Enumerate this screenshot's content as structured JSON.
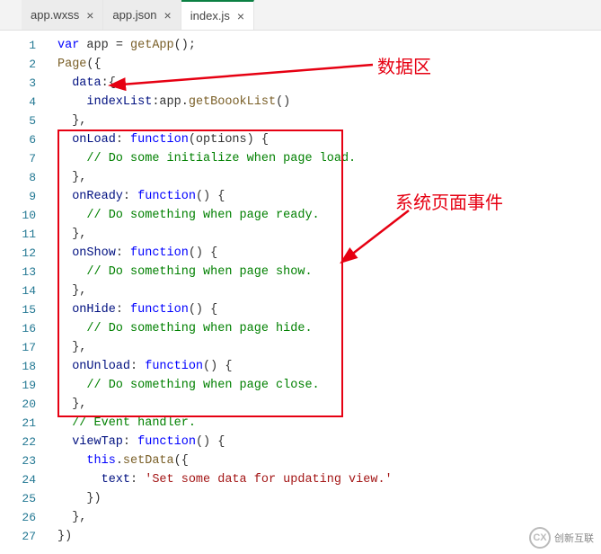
{
  "tabs": [
    {
      "label": "app.wxss",
      "active": false
    },
    {
      "label": "app.json",
      "active": false
    },
    {
      "label": "index.js",
      "active": true
    }
  ],
  "annotations": {
    "data_region": "数据区",
    "system_events": "系统页面事件"
  },
  "watermark": {
    "brand": "创新互联",
    "logo_text": "CX"
  },
  "code_lines": [
    {
      "n": 1,
      "segs": [
        [
          "kw",
          "var"
        ],
        [
          "punc",
          " app = "
        ],
        [
          "fn",
          "getApp"
        ],
        [
          "punc",
          "();"
        ]
      ]
    },
    {
      "n": 2,
      "segs": [
        [
          "fn",
          "Page"
        ],
        [
          "punc",
          "({"
        ]
      ]
    },
    {
      "n": 3,
      "segs": [
        [
          "punc",
          "  "
        ],
        [
          "prop",
          "data"
        ],
        [
          "punc",
          ":{"
        ]
      ]
    },
    {
      "n": 4,
      "segs": [
        [
          "punc",
          "    "
        ],
        [
          "prop",
          "indexList"
        ],
        [
          "punc",
          ":app."
        ],
        [
          "fn",
          "getBoookList"
        ],
        [
          "punc",
          "()"
        ]
      ]
    },
    {
      "n": 5,
      "segs": [
        [
          "punc",
          "  },"
        ]
      ]
    },
    {
      "n": 6,
      "segs": [
        [
          "punc",
          "  "
        ],
        [
          "prop",
          "onLoad"
        ],
        [
          "punc",
          ": "
        ],
        [
          "kw",
          "function"
        ],
        [
          "punc",
          "(options) {"
        ]
      ]
    },
    {
      "n": 7,
      "segs": [
        [
          "punc",
          "    "
        ],
        [
          "cm",
          "// Do some initialize when page load."
        ]
      ]
    },
    {
      "n": 8,
      "segs": [
        [
          "punc",
          "  },"
        ]
      ]
    },
    {
      "n": 9,
      "segs": [
        [
          "punc",
          "  "
        ],
        [
          "prop",
          "onReady"
        ],
        [
          "punc",
          ": "
        ],
        [
          "kw",
          "function"
        ],
        [
          "punc",
          "() {"
        ]
      ]
    },
    {
      "n": 10,
      "segs": [
        [
          "punc",
          "    "
        ],
        [
          "cm",
          "// Do something when page ready."
        ]
      ]
    },
    {
      "n": 11,
      "segs": [
        [
          "punc",
          "  },"
        ]
      ]
    },
    {
      "n": 12,
      "segs": [
        [
          "punc",
          "  "
        ],
        [
          "prop",
          "onShow"
        ],
        [
          "punc",
          ": "
        ],
        [
          "kw",
          "function"
        ],
        [
          "punc",
          "() {"
        ]
      ]
    },
    {
      "n": 13,
      "segs": [
        [
          "punc",
          "    "
        ],
        [
          "cm",
          "// Do something when page show."
        ]
      ]
    },
    {
      "n": 14,
      "segs": [
        [
          "punc",
          "  },"
        ]
      ]
    },
    {
      "n": 15,
      "segs": [
        [
          "punc",
          "  "
        ],
        [
          "prop",
          "onHide"
        ],
        [
          "punc",
          ": "
        ],
        [
          "kw",
          "function"
        ],
        [
          "punc",
          "() {"
        ]
      ]
    },
    {
      "n": 16,
      "segs": [
        [
          "punc",
          "    "
        ],
        [
          "cm",
          "// Do something when page hide."
        ]
      ]
    },
    {
      "n": 17,
      "segs": [
        [
          "punc",
          "  },"
        ]
      ]
    },
    {
      "n": 18,
      "segs": [
        [
          "punc",
          "  "
        ],
        [
          "prop",
          "onUnload"
        ],
        [
          "punc",
          ": "
        ],
        [
          "kw",
          "function"
        ],
        [
          "punc",
          "() {"
        ]
      ]
    },
    {
      "n": 19,
      "segs": [
        [
          "punc",
          "    "
        ],
        [
          "cm",
          "// Do something when page close."
        ]
      ]
    },
    {
      "n": 20,
      "segs": [
        [
          "punc",
          "  },"
        ]
      ]
    },
    {
      "n": 21,
      "segs": [
        [
          "punc",
          "  "
        ],
        [
          "cm",
          "// Event handler."
        ]
      ]
    },
    {
      "n": 22,
      "segs": [
        [
          "punc",
          "  "
        ],
        [
          "prop",
          "viewTap"
        ],
        [
          "punc",
          ": "
        ],
        [
          "kw",
          "function"
        ],
        [
          "punc",
          "() {"
        ]
      ]
    },
    {
      "n": 23,
      "segs": [
        [
          "punc",
          "    "
        ],
        [
          "kw",
          "this"
        ],
        [
          "punc",
          "."
        ],
        [
          "fn",
          "setData"
        ],
        [
          "punc",
          "({"
        ]
      ]
    },
    {
      "n": 24,
      "segs": [
        [
          "punc",
          "      "
        ],
        [
          "prop",
          "text"
        ],
        [
          "punc",
          ": "
        ],
        [
          "str",
          "'Set some data for updating view.'"
        ]
      ]
    },
    {
      "n": 25,
      "segs": [
        [
          "punc",
          "    })"
        ]
      ]
    },
    {
      "n": 26,
      "segs": [
        [
          "punc",
          "  },"
        ]
      ]
    },
    {
      "n": 27,
      "segs": [
        [
          "punc",
          "})"
        ]
      ]
    }
  ]
}
